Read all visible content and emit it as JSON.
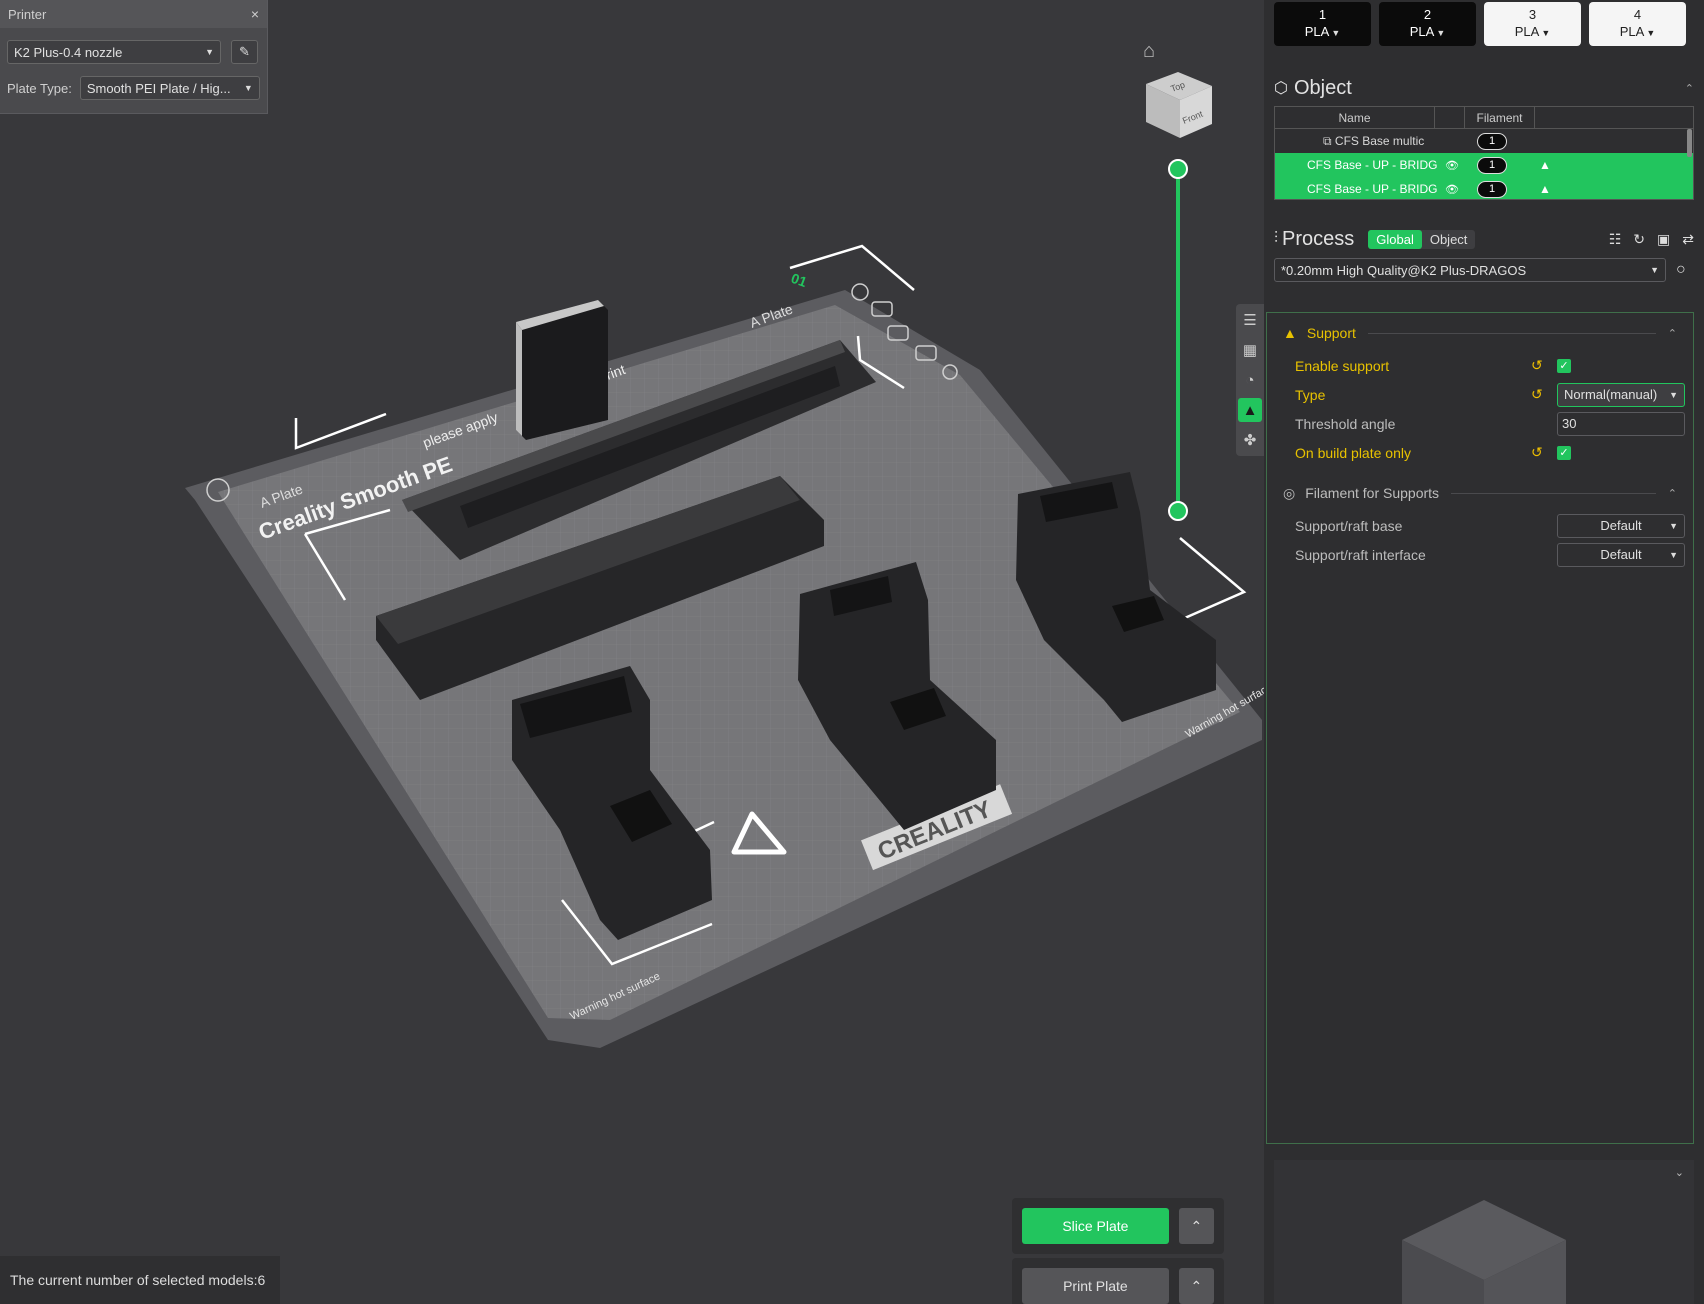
{
  "printer_panel": {
    "title": "Printer",
    "printer_name": "K2 Plus-0.4 nozzle",
    "plate_type_label": "Plate Type:",
    "plate_type_value": "Smooth PEI Plate / Hig..."
  },
  "viewcube": {
    "top": "Top",
    "front": "Front"
  },
  "plate_labels": {
    "plate_name": "Creality Smooth PE",
    "apply_text": "please apply",
    "print_text": "rint",
    "a_plate_left": "A Plate",
    "a_plate_right": "A Plate",
    "brand": "CREALITY",
    "warning_left": "Warning hot surface",
    "warning_right": "Warning hot surfac",
    "plate_number": "01"
  },
  "bottom": {
    "slice_label": "Slice Plate",
    "print_label": "Print Plate",
    "status": "The current number of selected models:6"
  },
  "filaments": [
    {
      "num": "1",
      "type": "PLA",
      "color": "black"
    },
    {
      "num": "2",
      "type": "PLA",
      "color": "black"
    },
    {
      "num": "3",
      "type": "PLA",
      "color": "white"
    },
    {
      "num": "4",
      "type": "PLA",
      "color": "white"
    }
  ],
  "object_panel": {
    "title": "Object",
    "col_name": "Name",
    "col_filament": "Filament",
    "rows": [
      {
        "name": "CFS Base multic",
        "filament": "1",
        "selected": false
      },
      {
        "name": "CFS Base - UP - BRIDGE",
        "filament": "1",
        "selected": true
      },
      {
        "name": "CFS Base - UP - BRIDGE",
        "filament": "1",
        "selected": true
      }
    ]
  },
  "process": {
    "title": "Process",
    "toggle_global": "Global",
    "toggle_object": "Object",
    "preset": "*0.20mm High Quality@K2 Plus-DRAGOS"
  },
  "support": {
    "title": "Support",
    "enable_label": "Enable support",
    "type_label": "Type",
    "type_value": "Normal(manual)",
    "threshold_label": "Threshold angle",
    "threshold_value": "30",
    "build_plate_label": "On build plate only"
  },
  "filament_supports": {
    "title": "Filament for Supports",
    "base_label": "Support/raft base",
    "base_value": "Default",
    "interface_label": "Support/raft interface",
    "interface_value": "Default"
  }
}
